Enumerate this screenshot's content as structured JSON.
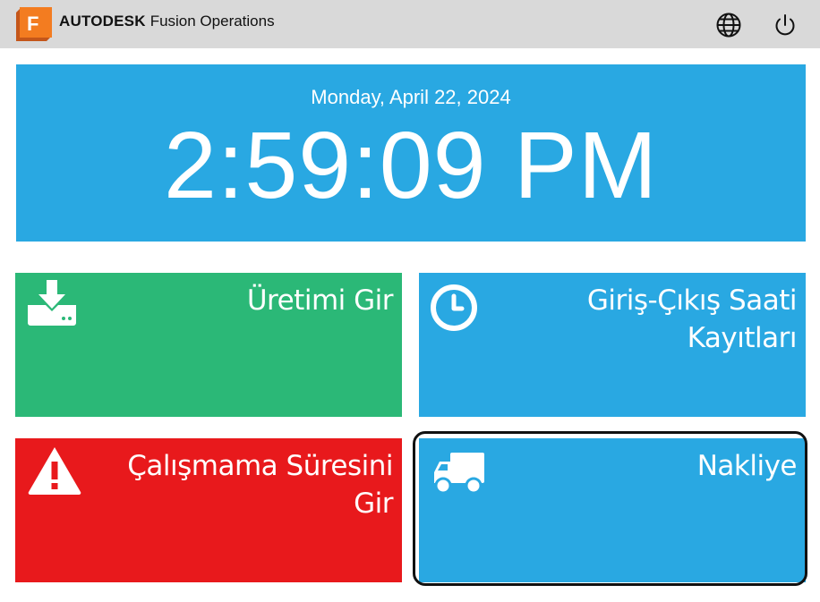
{
  "header": {
    "logo_letter": "F",
    "brand_primary": "AUTODESK",
    "brand_secondary": "Fusion Operations",
    "language_icon": "globe-icon",
    "power_icon": "power-icon"
  },
  "clock": {
    "date": "Monday, April 22, 2024",
    "time": "2:59:09 PM"
  },
  "tiles": [
    {
      "label_lines": [
        "Üretimi Gir"
      ],
      "icon": "download-icon",
      "color": "#2bb877"
    },
    {
      "label_lines": [
        "Giriş-Çıkış Saati",
        "Kayıtları"
      ],
      "icon": "clock-icon",
      "color": "#29a8e2"
    },
    {
      "label_lines": [
        "Çalışmama Süresini",
        "Gir"
      ],
      "icon": "warning-icon",
      "color": "#e8191c"
    },
    {
      "label_lines": [
        "Nakliye"
      ],
      "icon": "truck-icon",
      "color": "#29a8e2",
      "selected": true
    }
  ],
  "colors": {
    "topbar_bg": "#d9d9d9",
    "clock_bg": "#29a8e2",
    "logo_orange": "#f37c20"
  }
}
